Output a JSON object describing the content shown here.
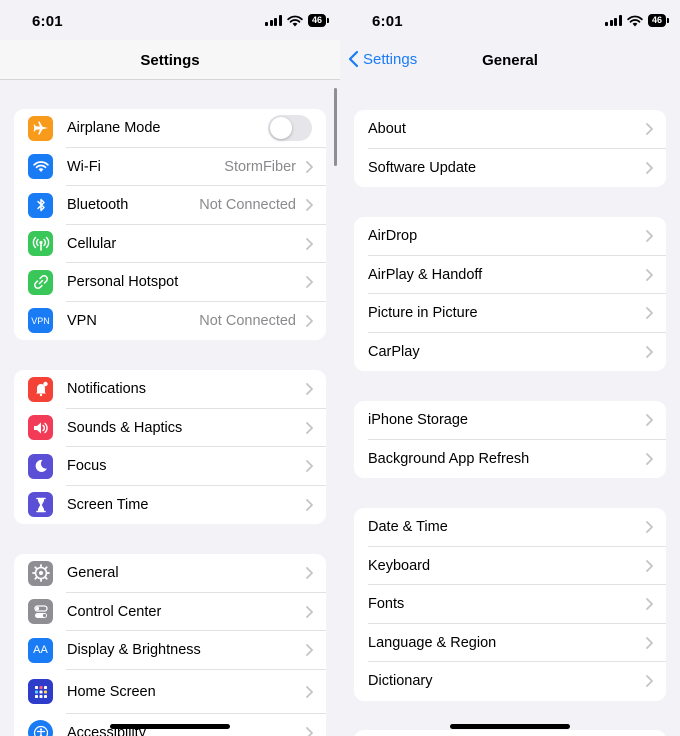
{
  "status": {
    "time": "6:01",
    "battery": "46"
  },
  "left": {
    "nav_title": "Settings",
    "groups": [
      [
        {
          "label": "Airplane Mode",
          "icon": "airplane-icon",
          "color": "#f89a1c",
          "toggle": false
        },
        {
          "label": "Wi-Fi",
          "value": "StormFiber",
          "icon": "wifi-icon",
          "color": "#1a7cf5"
        },
        {
          "label": "Bluetooth",
          "value": "Not Connected",
          "icon": "bluetooth-icon",
          "color": "#1a7cf5"
        },
        {
          "label": "Cellular",
          "icon": "cellular-icon",
          "color": "#3ac759"
        },
        {
          "label": "Personal Hotspot",
          "icon": "hotspot-icon",
          "color": "#3ac759"
        },
        {
          "label": "VPN",
          "value": "Not Connected",
          "icon": "vpn-icon",
          "icon_text": "VPN",
          "color": "#1a7cf5"
        }
      ],
      [
        {
          "label": "Notifications",
          "icon": "notifications-icon",
          "color": "#f44336"
        },
        {
          "label": "Sounds & Haptics",
          "icon": "speaker-icon",
          "color": "#f23b57"
        },
        {
          "label": "Focus",
          "icon": "moon-icon",
          "color": "#5b4fd5"
        },
        {
          "label": "Screen Time",
          "icon": "hourglass-icon",
          "color": "#5b4fd5"
        }
      ],
      [
        {
          "label": "General",
          "icon": "gear-icon",
          "color": "#8e8e93"
        },
        {
          "label": "Control Center",
          "icon": "control-center-icon",
          "color": "#8e8e93"
        },
        {
          "label": "Display & Brightness",
          "icon": "display-icon",
          "icon_text": "AA",
          "color": "#1a7cf5"
        },
        {
          "label": "Home Screen",
          "icon": "home-screen-icon",
          "color": "#2d3cc9"
        },
        {
          "label": "Accessibility",
          "icon": "accessibility-icon",
          "color": "#1a7cf5"
        }
      ]
    ]
  },
  "right": {
    "back_label": "Settings",
    "nav_title": "General",
    "groups": [
      [
        {
          "label": "About"
        },
        {
          "label": "Software Update"
        }
      ],
      [
        {
          "label": "AirDrop"
        },
        {
          "label": "AirPlay & Handoff"
        },
        {
          "label": "Picture in Picture"
        },
        {
          "label": "CarPlay"
        }
      ],
      [
        {
          "label": "iPhone Storage"
        },
        {
          "label": "Background App Refresh"
        }
      ],
      [
        {
          "label": "Date & Time"
        },
        {
          "label": "Keyboard"
        },
        {
          "label": "Fonts"
        },
        {
          "label": "Language & Region"
        },
        {
          "label": "Dictionary"
        }
      ]
    ]
  }
}
